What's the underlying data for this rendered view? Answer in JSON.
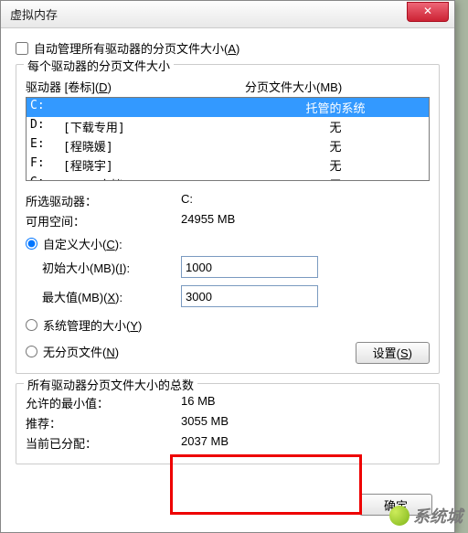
{
  "window": {
    "title": "虚拟内存"
  },
  "auto_manage": {
    "label_pre": "自动管理所有驱动器的分页文件大小(",
    "accel": "A",
    "label_post": ")"
  },
  "group1": {
    "title": "每个驱动器的分页文件大小",
    "header_col1_pre": "驱动器 [卷标](",
    "header_col1_accel": "D",
    "header_col1_post": ")",
    "header_col2": "分页文件大小(MB)",
    "drives": [
      {
        "letter": "C:",
        "label": "",
        "paging": "托管的系统",
        "selected": true
      },
      {
        "letter": "D:",
        "label": "[下载专用]",
        "paging": "无",
        "selected": false
      },
      {
        "letter": "E:",
        "label": "[程晓媛]",
        "paging": "无",
        "selected": false
      },
      {
        "letter": "F:",
        "label": "[程晓宇]",
        "paging": "无",
        "selected": false
      },
      {
        "letter": "G:",
        "label": "[PONE文档]",
        "paging": "无",
        "selected": false
      }
    ],
    "selected_drive_label": "所选驱动器：",
    "selected_drive_value": "C:",
    "free_space_label": "可用空间：",
    "free_space_value": "24955 MB",
    "custom_pre": "自定义大小(",
    "custom_accel": "C",
    "custom_post": "):",
    "initial_pre": "初始大小(MB)(",
    "initial_accel": "I",
    "initial_post": "):",
    "initial_value": "1000",
    "max_pre": "最大值(MB)(",
    "max_accel": "X",
    "max_post": "):",
    "max_value": "3000",
    "system_pre": "系统管理的大小(",
    "system_accel": "Y",
    "system_post": ")",
    "nopage_pre": "无分页文件(",
    "nopage_accel": "N",
    "nopage_post": ")",
    "set_btn_pre": "设置(",
    "set_btn_accel": "S",
    "set_btn_post": ")"
  },
  "group2": {
    "title": "所有驱动器分页文件大小的总数",
    "min_label": "允许的最小值：",
    "min_value": "16 MB",
    "rec_label": "推荐：",
    "rec_value": "3055 MB",
    "cur_label": "当前已分配：",
    "cur_value": "2037 MB"
  },
  "ok_btn": "确定",
  "watermark": "系统城"
}
